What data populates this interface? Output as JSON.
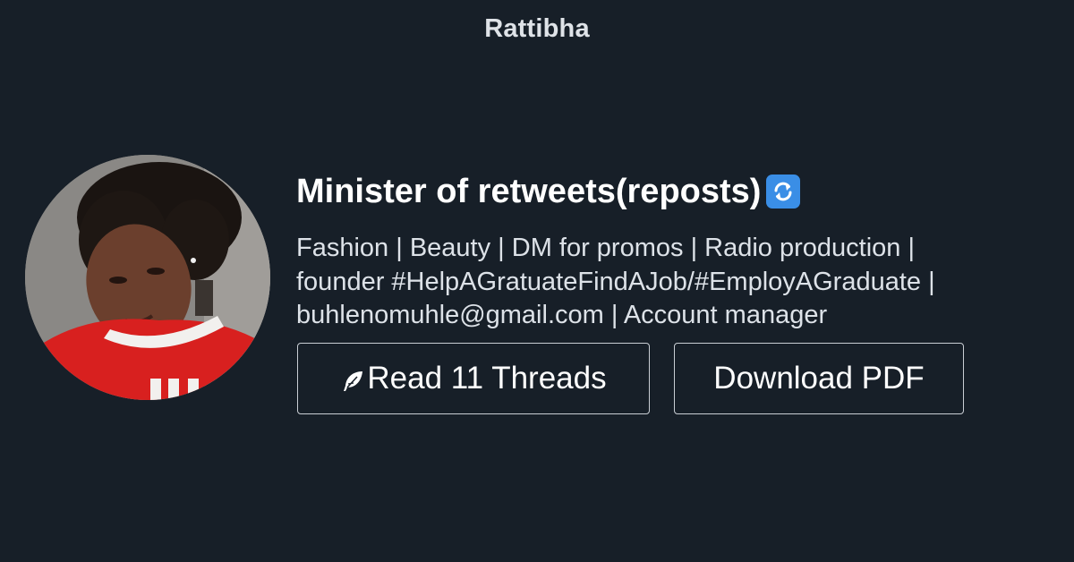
{
  "site": {
    "brand": "Rattibha"
  },
  "profile": {
    "display_name": "Minister of retweets(reposts)",
    "name_emoji": "repeat-arrows-emoji",
    "bio": "Fashion | Beauty | DM for promos | Radio production |\nfounder #HelpAGratuateFindAJob/#EmployAGraduate |\nbuhlenomuhle@gmail.com | Account manager",
    "avatar": "profile-photo"
  },
  "actions": {
    "read_label": "Read 11 Threads",
    "read_icon": "feather-icon",
    "pdf_label": "Download PDF"
  },
  "colors": {
    "background": "#171f28",
    "text": "#ffffff",
    "button_border": "#c9ced4",
    "emoji_badge": "#3a8ee6"
  }
}
